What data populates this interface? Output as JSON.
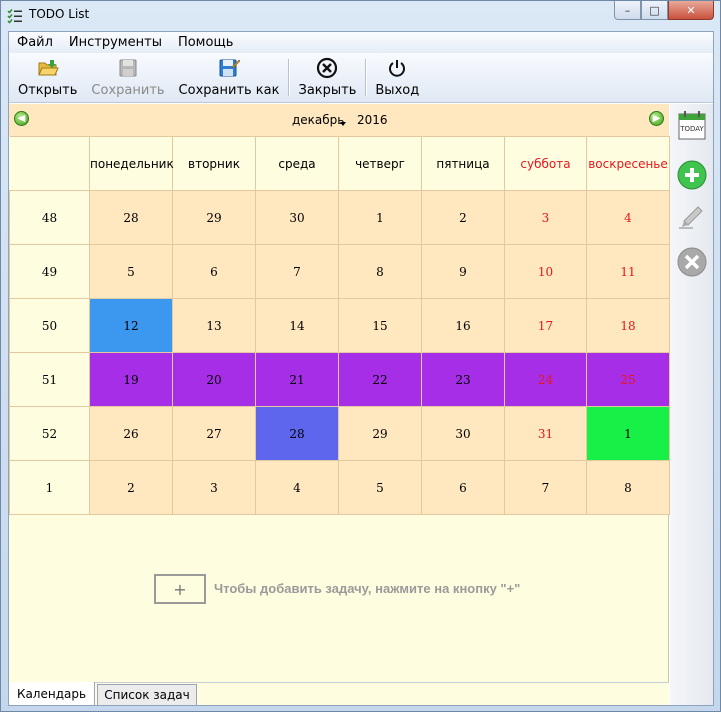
{
  "window": {
    "title": "TODO List",
    "minimize": "–",
    "maximize": "□",
    "close": "✕"
  },
  "menu": {
    "items": [
      "Файл",
      "Инструменты",
      "Помощь"
    ]
  },
  "toolbar": {
    "open": "Открыть",
    "save": "Сохранить",
    "save_as": "Сохранить как",
    "close": "Закрыть",
    "exit": "Выход"
  },
  "calendar": {
    "month": "декабрь",
    "year": "2016",
    "prev": "◀",
    "next": "▶",
    "weekdays": [
      "понедельник",
      "вторник",
      "среда",
      "четверг",
      "пятница",
      "суббота",
      "воскресенье"
    ],
    "weekend_color": "#e8161b",
    "weeks": [
      {
        "week": "48",
        "days": [
          "28",
          "29",
          "30",
          "1",
          "2",
          "3",
          "4"
        ],
        "colors": [
          null,
          null,
          null,
          null,
          null,
          null,
          null
        ]
      },
      {
        "week": "49",
        "days": [
          "5",
          "6",
          "7",
          "8",
          "9",
          "10",
          "11"
        ],
        "colors": [
          null,
          null,
          null,
          null,
          null,
          null,
          null
        ]
      },
      {
        "week": "50",
        "days": [
          "12",
          "13",
          "14",
          "15",
          "16",
          "17",
          "18"
        ],
        "colors": [
          "#3b98ee",
          null,
          null,
          null,
          null,
          null,
          null
        ]
      },
      {
        "week": "51",
        "days": [
          "19",
          "20",
          "21",
          "22",
          "23",
          "24",
          "25"
        ],
        "colors": [
          "#a52ee6",
          "#a52ee6",
          "#a52ee6",
          "#a52ee6",
          "#a52ee6",
          "#a52ee6",
          "#a52ee6"
        ]
      },
      {
        "week": "52",
        "days": [
          "26",
          "27",
          "28",
          "29",
          "30",
          "31",
          "1"
        ],
        "colors": [
          null,
          null,
          "#5e66ee",
          null,
          null,
          null,
          "#17f047"
        ]
      },
      {
        "week": "1",
        "days": [
          "2",
          "3",
          "4",
          "5",
          "6",
          "7",
          "8"
        ],
        "colors": [
          null,
          null,
          null,
          null,
          null,
          null,
          null
        ]
      }
    ],
    "red_cells": [
      [
        "0-5",
        "0-6"
      ],
      [
        "1-5",
        "1-6"
      ],
      [
        "2-5",
        "2-6"
      ],
      [
        "3-5",
        "3-6"
      ],
      [
        "4-5"
      ]
    ]
  },
  "hint": {
    "add_button": "+",
    "text": "Чтобы добавить задачу, нажмите на кнопку \"+\""
  },
  "tabs": {
    "calendar": "Календарь",
    "task_list": "Список задач"
  },
  "side": {
    "today_label": "TODAY"
  }
}
